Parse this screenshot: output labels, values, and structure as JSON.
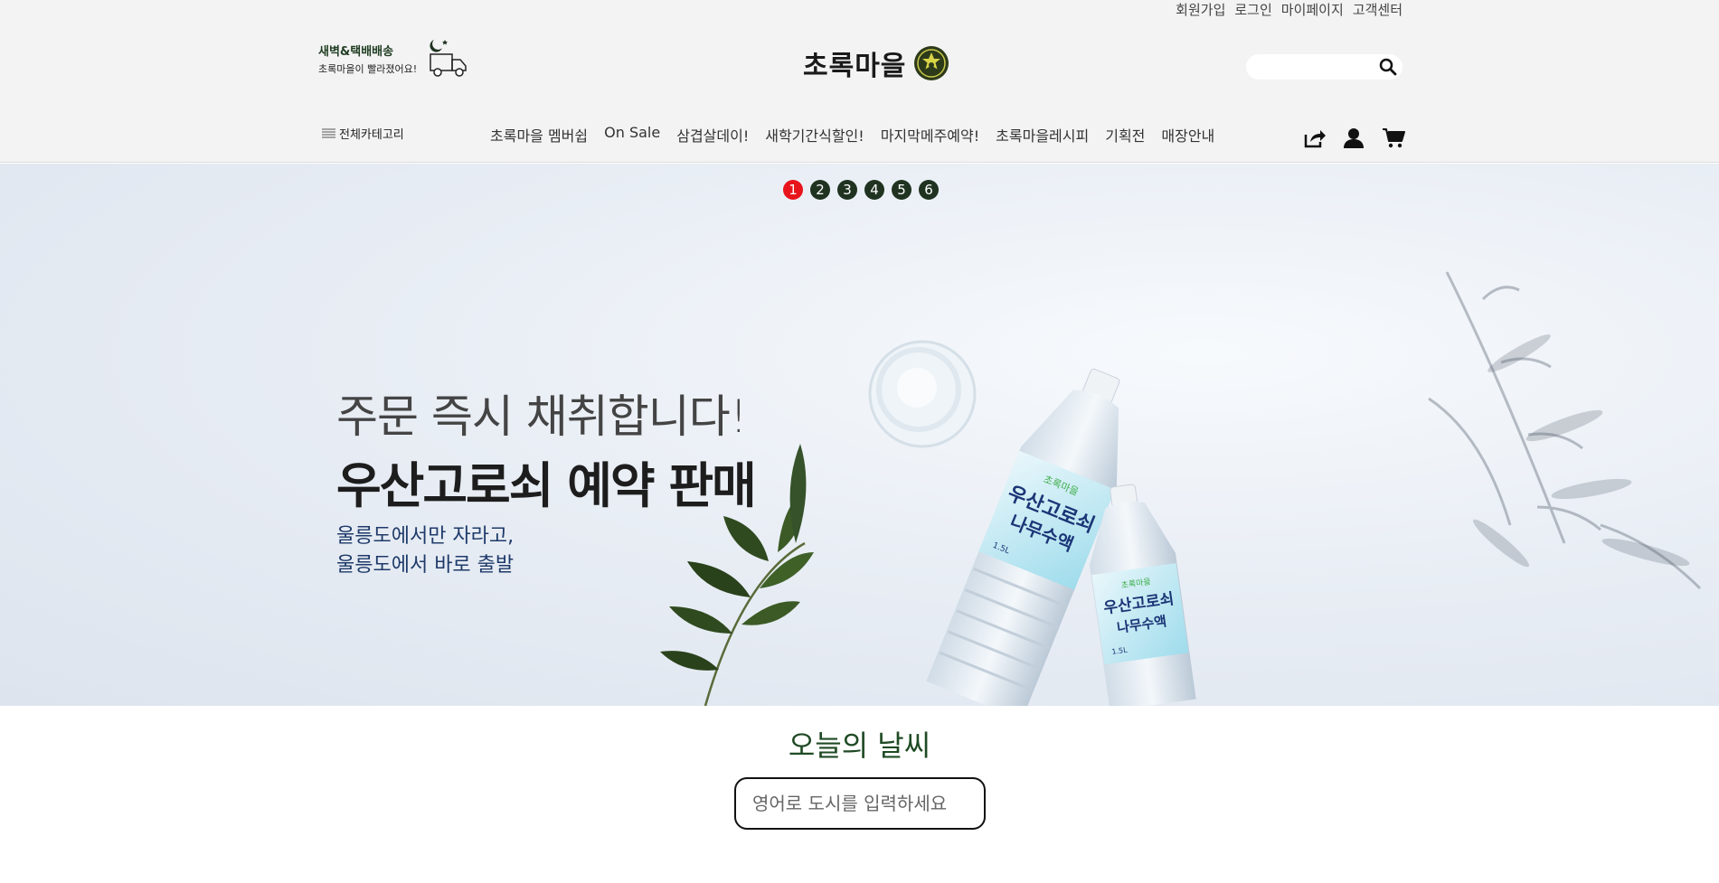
{
  "top_links": [
    "회원가입",
    "로그인",
    "마이페이지",
    "고객센터"
  ],
  "delivery": {
    "title": "새벽&택배배송",
    "subtitle": "초록마을이 빨라졌어요!"
  },
  "logo": {
    "text": "초록마을"
  },
  "search": {
    "placeholder": ""
  },
  "all_categories": "전체카테고리",
  "nav_items": [
    "초록마을 멤버쉽",
    "On Sale",
    "삼겹살데이!",
    "새학기간식할인!",
    "마지막메주예약!",
    "초록마을레시피",
    "기획전",
    "매장안내"
  ],
  "banner": {
    "dots": [
      "1",
      "2",
      "3",
      "4",
      "5",
      "6"
    ],
    "active_dot": 1,
    "headline1": "주문 즉시 채취합니다!",
    "headline2": "우산고로쇠 예약 판매",
    "subline1": "울릉도에서만 자라고,",
    "subline2": "울릉도에서 바로 출발",
    "bottle_label_1": "우산고로쇠",
    "bottle_label_2": "나무수액",
    "bottle_label_top": "초록마을",
    "bottle_volume": "1.5L"
  },
  "weather": {
    "title": "오늘의 날씨",
    "placeholder": "영어로 도시를 입력하세요"
  },
  "colors": {
    "accent_green": "#1f4a24",
    "active_dot": "#e8141c",
    "dot": "#1f3320",
    "header_bg": "#f3f3f3"
  }
}
